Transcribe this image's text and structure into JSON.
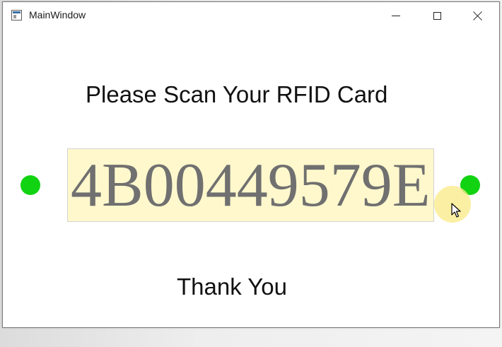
{
  "window": {
    "title": "MainWindow",
    "icon": "app-window-icon",
    "controls": {
      "minimize_icon": "minimize-icon",
      "maximize_icon": "maximize-icon",
      "close_icon": "close-icon"
    }
  },
  "main": {
    "prompt": "Please Scan Your RFID Card",
    "card_id": "4B00449579E",
    "message": "Thank You",
    "status_indicators": [
      {
        "side": "left",
        "color": "#12d312"
      },
      {
        "side": "right",
        "color": "#12d312"
      }
    ]
  },
  "colors": {
    "card_background": "#fff8cc",
    "card_text": "#707070",
    "indicator": "#12d312"
  }
}
